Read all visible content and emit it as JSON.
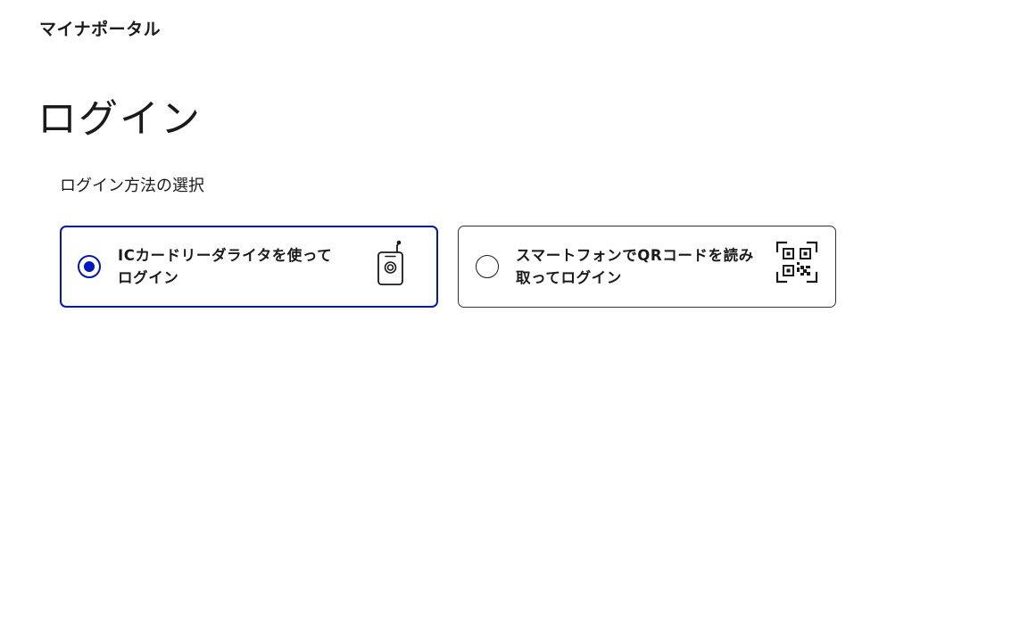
{
  "app": {
    "brand": "マイナポータル"
  },
  "page": {
    "title": "ログイン"
  },
  "login_method": {
    "label": "ログイン方法の選択",
    "selected": "ic-card-reader",
    "options": [
      {
        "id": "ic-card-reader",
        "label": "ICカードリーダライタを使ってログイン",
        "icon": "card-reader-icon",
        "selected": true
      },
      {
        "id": "smartphone-qr",
        "label": "スマートフォンでQRコードを読み取ってログイン",
        "icon": "qr-code-icon",
        "selected": false
      }
    ]
  },
  "colors": {
    "accent": "#0017c1",
    "text": "#1a1a1c",
    "border": "#333333",
    "background": "#ffffff"
  }
}
